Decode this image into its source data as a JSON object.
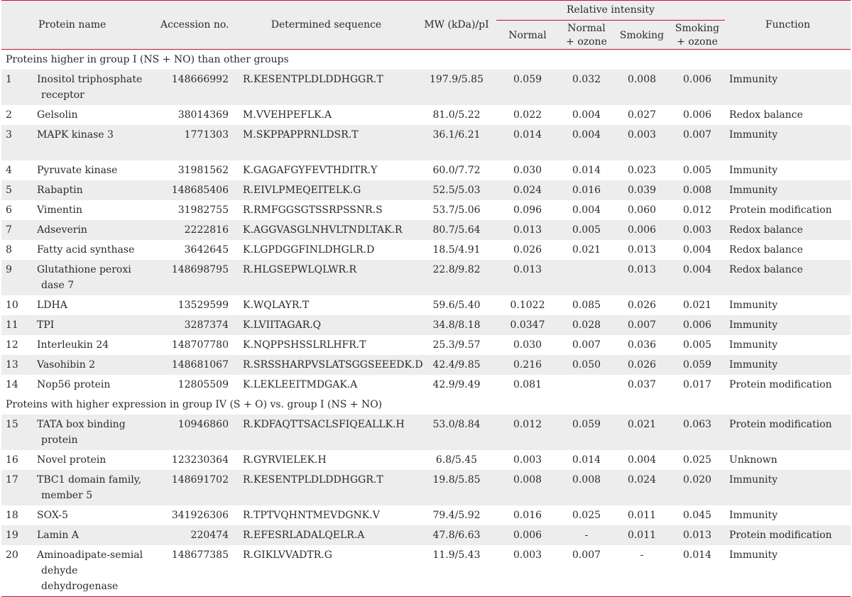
{
  "headers": {
    "protein_name": "Protein name",
    "accession": "Accession no.",
    "sequence": "Determined sequence",
    "mw_pi": "MW (kDa)/pI",
    "relative_intensity": "Relative intensity",
    "normal": "Normal",
    "normal_ozone_1": "Normal",
    "normal_ozone_2": "+ ozone",
    "smoking": "Smoking",
    "smoking_ozone_1": "Smoking",
    "smoking_ozone_2": "+ ozone",
    "function": "Function"
  },
  "sections": [
    {
      "title": "Proteins higher in group I (NS + NO) than other groups",
      "rows": [
        {
          "no": "1",
          "name": [
            "Inositol triphosphate",
            "receptor"
          ],
          "acc": "148666992",
          "seq": "R.KESENTPLDLDDHGGR.T",
          "mw": "197.9/5.85",
          "n": "0.059",
          "no3": "0.032",
          "s": "0.008",
          "so": "0.006",
          "fn": "Immunity"
        },
        {
          "no": "2",
          "name": [
            "Gelsolin"
          ],
          "acc": "38014369",
          "seq": "M.VVEHPEFLK.A",
          "mw": "81.0/5.22",
          "n": "0.022",
          "no3": "0.004",
          "s": "0.027",
          "so": "0.006",
          "fn": "Redox balance"
        },
        {
          "no": "3",
          "name": [
            "MAPK kinase 3"
          ],
          "acc": "1771303",
          "seq": "M.SKPPAPPRNLDSR.T",
          "mw": "36.1/6.21",
          "n": "0.014",
          "no3": "0.004",
          "s": "0.003",
          "so": "0.007",
          "fn": "Immunity",
          "tall": true
        },
        {
          "no": "4",
          "name": [
            "Pyruvate kinase"
          ],
          "acc": "31981562",
          "seq": "K.GAGAFGYFEVTHDITR.Y",
          "mw": "60.0/7.72",
          "n": "0.030",
          "no3": "0.014",
          "s": "0.023",
          "so": "0.005",
          "fn": "Immunity"
        },
        {
          "no": "5",
          "name": [
            "Rabaptin"
          ],
          "acc": "148685406",
          "seq": "R.EIVLPMEQEITELK.G",
          "mw": "52.5/5.03",
          "n": "0.024",
          "no3": "0.016",
          "s": "0.039",
          "so": "0.008",
          "fn": "Immunity"
        },
        {
          "no": "6",
          "name": [
            "Vimentin"
          ],
          "acc": "31982755",
          "seq": "R.RMFGGSGTSSRPSSNR.S",
          "mw": "53.7/5.06",
          "n": "0.096",
          "no3": "0.004",
          "s": "0.060",
          "so": "0.012",
          "fn": "Protein modification"
        },
        {
          "no": "7",
          "name": [
            "Adseverin"
          ],
          "acc": "2222816",
          "seq": "K.AGGVASGLNHVLTNDLTAK.R",
          "mw": "80.7/5.64",
          "n": "0.013",
          "no3": "0.005",
          "s": "0.006",
          "so": "0.003",
          "fn": "Redox balance"
        },
        {
          "no": "8",
          "name": [
            "Fatty acid synthase"
          ],
          "acc": "3642645",
          "seq": "K.LGPDGGFINLDHGLR.D",
          "mw": "18.5/4.91",
          "n": "0.026",
          "no3": "0.021",
          "s": "0.013",
          "so": "0.004",
          "fn": "Redox balance"
        },
        {
          "no": "9",
          "name": [
            "Glutathione peroxi",
            "dase 7"
          ],
          "acc": "148698795",
          "seq": "R.HLGSEPWLQLWR.R",
          "mw": "22.8/9.82",
          "n": "0.013",
          "no3": "",
          "s": "0.013",
          "so": "0.004",
          "fn": "Redox balance"
        },
        {
          "no": "10",
          "name": [
            "LDHA"
          ],
          "acc": "13529599",
          "seq": "K.WQLAYR.T",
          "mw": "59.6/5.40",
          "n": "0.1022",
          "no3": "0.085",
          "s": "0.026",
          "so": "0.021",
          "fn": "Immunity"
        },
        {
          "no": "11",
          "name": [
            "TPI"
          ],
          "acc": "3287374",
          "seq": "K.LVIITAGAR.Q",
          "mw": "34.8/8.18",
          "n": "0.0347",
          "no3": "0.028",
          "s": "0.007",
          "so": "0.006",
          "fn": "Immunity"
        },
        {
          "no": "12",
          "name": [
            "Interleukin 24"
          ],
          "acc": "148707780",
          "seq": "K.NQPPSHSSLRLHFR.T",
          "mw": "25.3/9.57",
          "n": "0.030",
          "no3": "0.007",
          "s": "0.036",
          "so": "0.005",
          "fn": "Immunity"
        },
        {
          "no": "13",
          "name": [
            "Vasohibin 2"
          ],
          "acc": "148681067",
          "seq": "R.SRSSHARPVSLATSGGSEEEDK.D",
          "mw": "42.4/9.85",
          "n": "0.216",
          "no3": "0.050",
          "s": "0.026",
          "so": "0.059",
          "fn": "Immunity"
        },
        {
          "no": "14",
          "name": [
            "Nop56 protein"
          ],
          "acc": "12805509",
          "seq": "K.LEKLEEITMDGAK.A",
          "mw": "42.9/9.49",
          "n": "0.081",
          "no3": "",
          "s": "0.037",
          "so": "0.017",
          "fn": "Protein modification"
        }
      ]
    },
    {
      "title": "Proteins with higher expression in group IV (S + O) vs. group I (NS + NO)",
      "rows": [
        {
          "no": "15",
          "name": [
            "TATA box binding",
            "protein"
          ],
          "acc": "10946860",
          "seq": "R.KDFAQTTSACLSFIQEALLK.H",
          "mw": "53.0/8.84",
          "n": "0.012",
          "no3": "0.059",
          "s": "0.021",
          "so": "0.063",
          "fn": "Protein modification"
        },
        {
          "no": "16",
          "name": [
            "Novel protein"
          ],
          "acc": "123230364",
          "seq": "R.GYRVIELEK.H",
          "mw": "6.8/5.45",
          "n": "0.003",
          "no3": "0.014",
          "s": "0.004",
          "so": "0.025",
          "fn": "Unknown"
        },
        {
          "no": "17",
          "name": [
            "TBC1 domain family,",
            "member 5"
          ],
          "acc": "148691702",
          "seq": "R.KESENTPLDLDDHGGR.T",
          "mw": "19.8/5.85",
          "n": "0.008",
          "no3": "0.008",
          "s": "0.024",
          "so": "0.020",
          "fn": "Immunity"
        },
        {
          "no": "18",
          "name": [
            "SOX-5"
          ],
          "acc": "341926306",
          "seq": "R.TPTVQHNTMEVDGNK.V",
          "mw": "79.4/5.92",
          "n": "0.016",
          "no3": "0.025",
          "s": "0.011",
          "so": "0.045",
          "fn": "Immunity"
        },
        {
          "no": "19",
          "name": [
            "Lamin A"
          ],
          "acc": "220474",
          "seq": "R.EFESRLADALQELR.A",
          "mw": "47.8/6.63",
          "n": "0.006",
          "no3": "-",
          "s": "0.011",
          "so": "0.013",
          "fn": "Protein modification"
        },
        {
          "no": "20",
          "name": [
            "Aminoadipate-semial",
            "dehyde dehydrogenase"
          ],
          "acc": "148677385",
          "seq": "R.GIKLVVADTR.G",
          "mw": "11.9/5.43",
          "n": "0.003",
          "no3": "0.007",
          "s": "-",
          "so": "0.014",
          "fn": "Immunity"
        }
      ]
    }
  ]
}
